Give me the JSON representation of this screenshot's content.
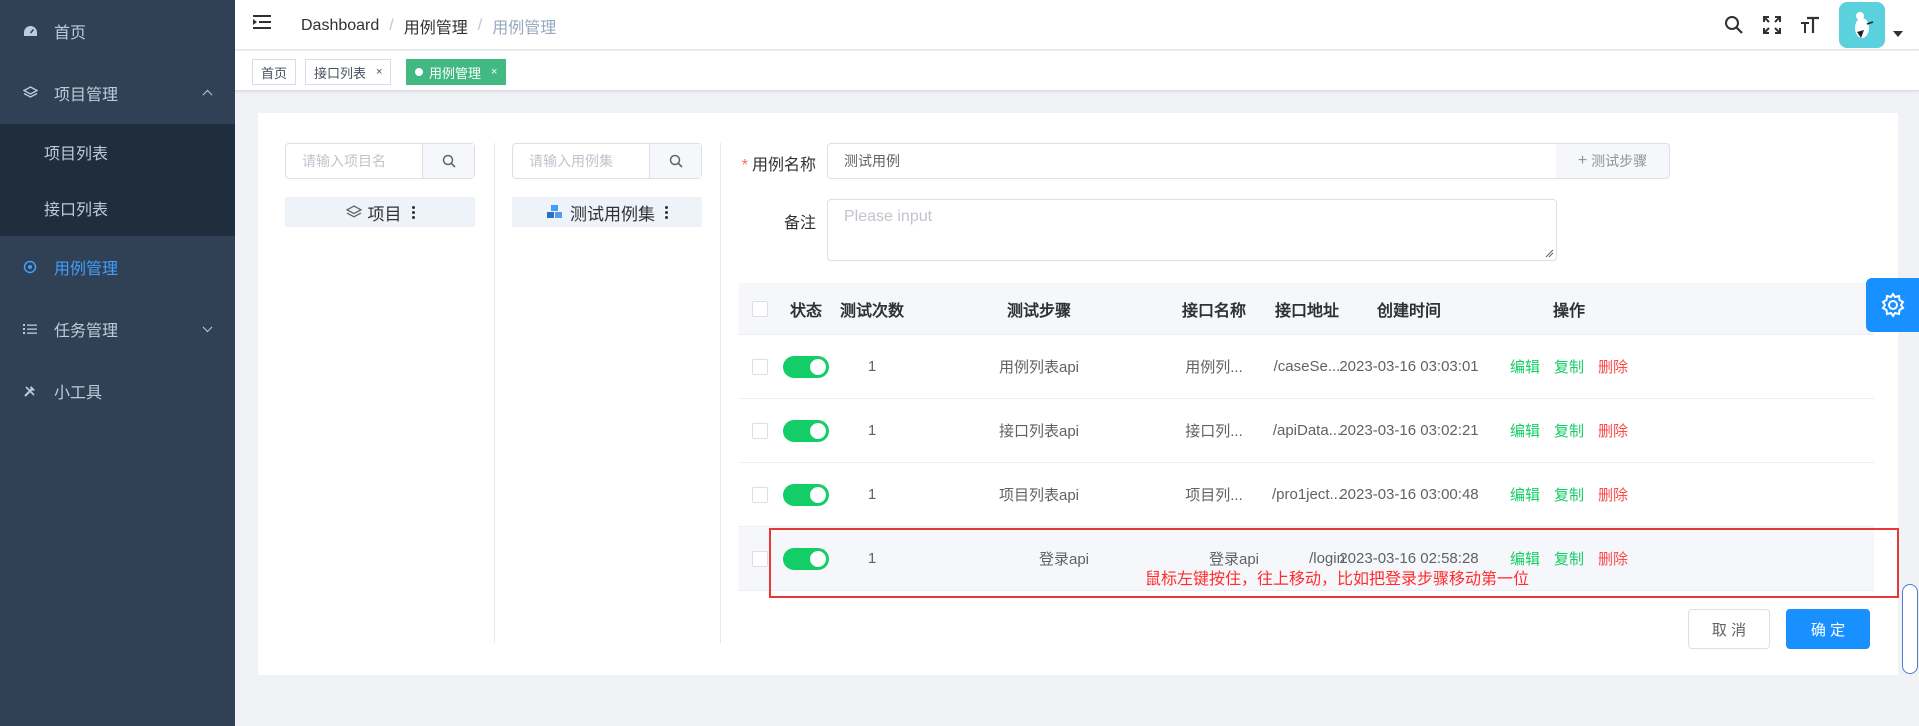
{
  "sidebar": {
    "items": [
      {
        "label": "首页",
        "icon": "dashboard-icon"
      },
      {
        "label": "项目管理",
        "icon": "layers-icon"
      },
      {
        "label": "项目列表"
      },
      {
        "label": "接口列表"
      },
      {
        "label": "用例管理",
        "icon": "target-icon"
      },
      {
        "label": "任务管理",
        "icon": "list-icon"
      },
      {
        "label": "小工具",
        "icon": "tools-icon"
      }
    ],
    "active_color": "#409eff",
    "bg_color": "#304156"
  },
  "breadcrumb": [
    "Dashboard",
    "用例管理",
    "用例管理"
  ],
  "tags": [
    {
      "label": "首页"
    },
    {
      "label": "接口列表",
      "close": "×"
    },
    {
      "label": "用例管理",
      "close": "×"
    }
  ],
  "project_panel": {
    "search_placeholder": "请输入项目名",
    "node_label": "项目"
  },
  "caseset_panel": {
    "search_placeholder": "请输入用例集",
    "node_label": "测试用例集"
  },
  "form": {
    "name_label": "用例名称",
    "required_mark": "*",
    "name_value": "测试用例",
    "add_step_label": "测试步骤",
    "remark_label": "备注",
    "remark_placeholder": "Please input"
  },
  "table": {
    "headers": [
      "状态",
      "测试次数",
      "测试步骤",
      "接口名称",
      "接口地址",
      "创建时间",
      "操作"
    ],
    "rows": [
      {
        "count": "1",
        "step": "用例列表api",
        "api_name": "用例列...",
        "api_url": "/caseSe...",
        "created": "2023-03-16 03:03:01"
      },
      {
        "count": "1",
        "step": "接口列表api",
        "api_name": "接口列...",
        "api_url": "/apiData...",
        "created": "2023-03-16 03:02:21"
      },
      {
        "count": "1",
        "step": "项目列表api",
        "api_name": "项目列...",
        "api_url": "/pro1ject...",
        "created": "2023-03-16 03:00:48"
      },
      {
        "count": "1",
        "step": "登录api",
        "api_name": "登录api",
        "api_url": "/login",
        "created": "2023-03-16 02:58:28"
      }
    ],
    "actions": {
      "edit": "编辑",
      "copy": "复制",
      "delete": "删除"
    },
    "switch_on_color": "#13ce66"
  },
  "annotation": "鼠标左键按住，往上移动，比如把登录步骤移动第一位",
  "buttons": {
    "cancel": "取 消",
    "confirm": "确 定"
  },
  "colors": {
    "primary": "#1890ff",
    "danger": "#ff4949",
    "success": "#13ce66",
    "annotation": "#e53935"
  }
}
